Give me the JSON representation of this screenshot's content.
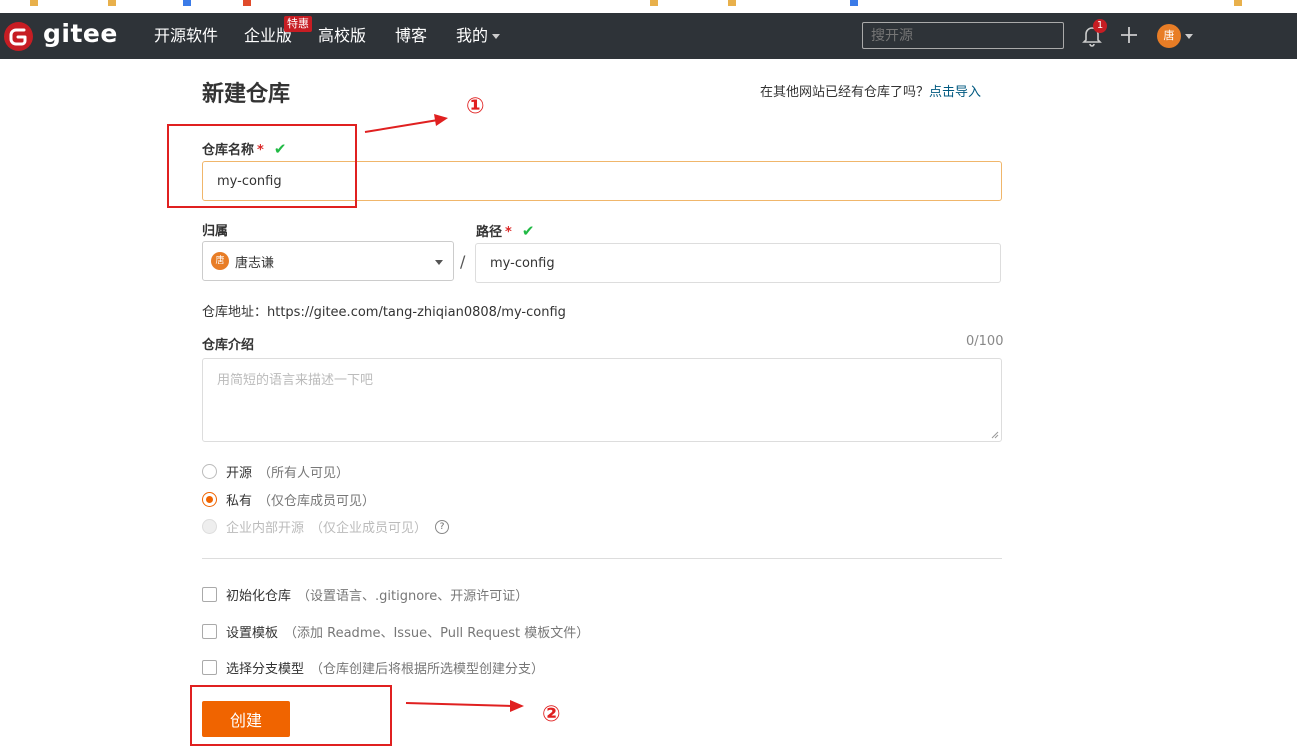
{
  "nav": {
    "logo_text": "gitee",
    "items": [
      {
        "label": "开源软件"
      },
      {
        "label": "企业版"
      },
      {
        "label": "高校版"
      },
      {
        "label": "博客"
      },
      {
        "label": "我的"
      }
    ],
    "enterprise_badge": "特惠",
    "search_placeholder": "搜开源",
    "notification_count": "1",
    "avatar_char": "唐"
  },
  "page": {
    "title": "新建仓库",
    "import_prompt": "在其他网站已经有仓库了吗？",
    "import_link": "点击导入"
  },
  "form": {
    "repo_name_label": "仓库名称",
    "required_mark": "*",
    "check_mark": "✔",
    "repo_name_value": "my-config",
    "owner_label": "归属",
    "owner_avatar_char": "唐",
    "owner_value": "唐志谦",
    "slash": "/",
    "path_label": "路径",
    "path_value": "my-config",
    "repo_address": "仓库地址：https://gitee.com/tang-zhiqian0808/my-config",
    "intro_label": "仓库介绍",
    "intro_counter": "0/100",
    "intro_placeholder": "用简短的语言来描述一下吧",
    "visibility": [
      {
        "label": "开源",
        "hint": "（所有人可见）",
        "state": "off"
      },
      {
        "label": "私有",
        "hint": "（仅仓库成员可见）",
        "state": "on"
      },
      {
        "label": "企业内部开源",
        "hint": "（仅企业成员可见）",
        "state": "disabled"
      }
    ],
    "help_icon_char": "?",
    "options": [
      {
        "label": "初始化仓库",
        "hint": "（设置语言、.gitignore、开源许可证）"
      },
      {
        "label": "设置模板",
        "hint": "（添加 Readme、Issue、Pull Request 模板文件）"
      },
      {
        "label": "选择分支模型",
        "hint": "（仓库创建后将根据所选模型创建分支）"
      }
    ],
    "create_button": "创建"
  },
  "annotations": {
    "step1": "①",
    "step2": "②",
    "color": "#e02020"
  },
  "colors": {
    "nav_bg": "#2e3338",
    "brand_red": "#c71d23",
    "accent_orange": "#f06400",
    "link_blue": "#005980",
    "valid_green": "#21ba45"
  }
}
